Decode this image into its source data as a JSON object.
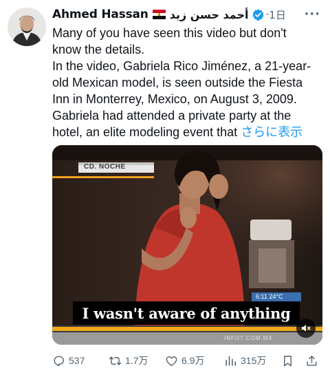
{
  "author": {
    "display_name": "Ahmed Hassan",
    "flag_icon": "egypt-flag-icon",
    "arabic_name": "أحمد حسن زيد",
    "verified_icon": "verified-badge-icon",
    "separator": "·",
    "timestamp": "1日",
    "more_icon": "more-options-icon"
  },
  "post": {
    "lines": [
      "Many of you have seen this video but don't",
      "know the details.",
      "In the video, Gabriela Rico Jiménez, a 21-year-",
      "old Mexican model, is seen outside the Fiesta",
      "Inn in Monterrey, Mexico, on August 3, 2009.",
      "Gabriela had attended a private party at the",
      "hotel, an elite modeling event that "
    ],
    "show_more": "さらに表示"
  },
  "video": {
    "channel_tag": "CD. NOCHE",
    "clock": "6:11  24°C",
    "caption": "I wasn't aware of anything",
    "watermark": "INFO7.COM.MX",
    "mute_icon": "muted-speaker-icon"
  },
  "actions": {
    "replies": "537",
    "reposts": "1.7万",
    "likes": "6.9万",
    "views": "315万",
    "reply_icon": "reply-icon",
    "repost_icon": "repost-icon",
    "like_icon": "heart-icon",
    "views_icon": "views-chart-icon",
    "bookmark_icon": "bookmark-icon",
    "share_icon": "share-icon"
  },
  "colors": {
    "text": "#0f1419",
    "secondary": "#536471",
    "link": "#1d9bf0",
    "verified": "#1d9bf0"
  }
}
